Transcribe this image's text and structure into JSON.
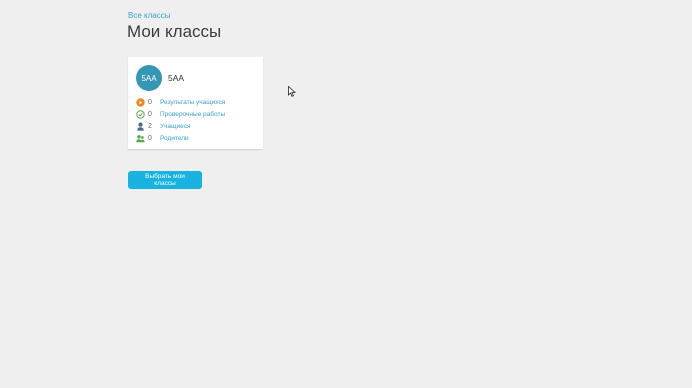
{
  "header": {
    "breadcrumb": "Все классы",
    "title": "Мои классы"
  },
  "class_card": {
    "avatar_text": "5АА",
    "name": "5АА",
    "stats": [
      {
        "icon": "play-circle-icon",
        "count": "0",
        "label": "Результаты учащихся",
        "color": "#f0861c"
      },
      {
        "icon": "check-circle-icon",
        "count": "0",
        "label": "Проверочные работы",
        "color": "#5aa64a"
      },
      {
        "icon": "student-icon",
        "count": "2",
        "label": "Учащиеся",
        "color": "#3f6f8a"
      },
      {
        "icon": "parents-icon",
        "count": "0",
        "label": "Родители",
        "color": "#5aa64a"
      }
    ]
  },
  "actions": {
    "select_button": "Выбрать мои классы"
  },
  "colors": {
    "background": "#efefef",
    "link": "#3aa0c8",
    "avatar": "#3596b5",
    "button": "#17b2df"
  }
}
